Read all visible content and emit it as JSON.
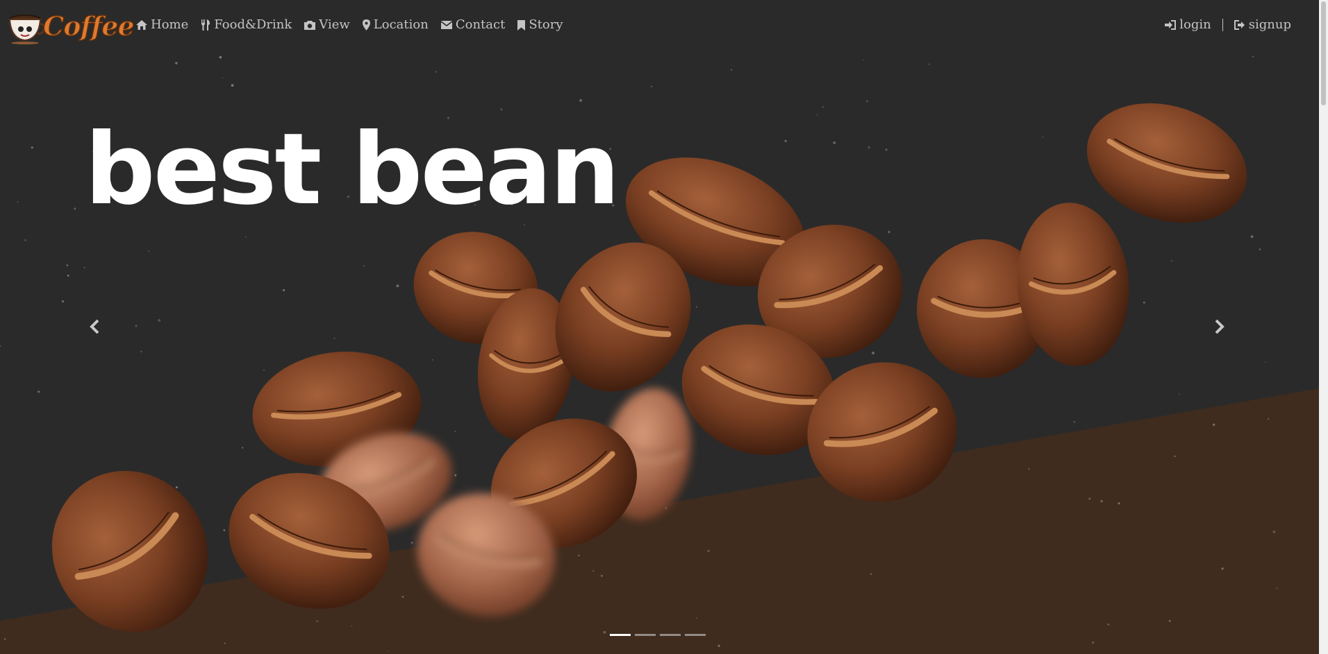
{
  "brand": {
    "logo_text": "Coffee",
    "logo_color": "#e07a2e"
  },
  "nav": {
    "left": [
      {
        "icon": "home-icon",
        "label": "Home"
      },
      {
        "icon": "cutlery-icon",
        "label": "Food&Drink"
      },
      {
        "icon": "camera-icon",
        "label": "View"
      },
      {
        "icon": "map-marker-icon",
        "label": "Location"
      },
      {
        "icon": "envelope-icon",
        "label": "Contact"
      },
      {
        "icon": "bookmark-icon",
        "label": "Story"
      }
    ],
    "right": [
      {
        "icon": "login-icon",
        "label": "login"
      },
      {
        "icon": "signup-icon",
        "label": "signup"
      }
    ]
  },
  "carousel": {
    "headline": "best bean",
    "slide_count": 4,
    "active_index": 0
  },
  "colors": {
    "background": "#2a2a2a",
    "accent_brown": "#3f2c1f",
    "bean_brown": "#7a3f22",
    "nav_text": "#c4c4c4"
  }
}
